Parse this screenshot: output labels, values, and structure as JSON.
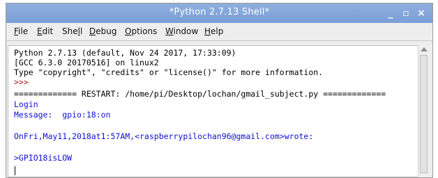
{
  "window": {
    "title": "*Python 2.7.13 Shell*",
    "controls": {
      "minimize": "_",
      "maximize": "▫",
      "close": "×"
    }
  },
  "menu": {
    "file": {
      "mnemonic": "F",
      "rest": "ile"
    },
    "edit": {
      "mnemonic": "E",
      "rest": "dit"
    },
    "shell": {
      "pre": "She",
      "mnemonic": "l",
      "rest": "l"
    },
    "debug": {
      "mnemonic": "D",
      "rest": "ebug"
    },
    "options": {
      "mnemonic": "O",
      "rest": "ptions"
    },
    "window": {
      "mnemonic": "W",
      "rest": "indow"
    },
    "help": {
      "mnemonic": "H",
      "rest": "elp"
    }
  },
  "shell": {
    "lines": [
      "Python 2.7.13 (default, Nov 24 2017, 17:33:09)",
      "[GCC 6.3.0 20170516] on linux2",
      "Type \"copyright\", \"credits\" or \"license()\" for more information.",
      ">>>",
      "============= RESTART: /home/pi/Desktop/lochan/gmail_subject.py =============",
      "Login",
      "Message:  gpio:18:on",
      "OnFri,May11,2018at1:57AM,<raspberrypilochan96@gmail.com>wrote:",
      ">GPIO18isLOW"
    ]
  },
  "colors": {
    "titlebar": "#7fa2d9",
    "prompt": "#a31515",
    "output": "#1010d0",
    "normal": "#000000"
  }
}
